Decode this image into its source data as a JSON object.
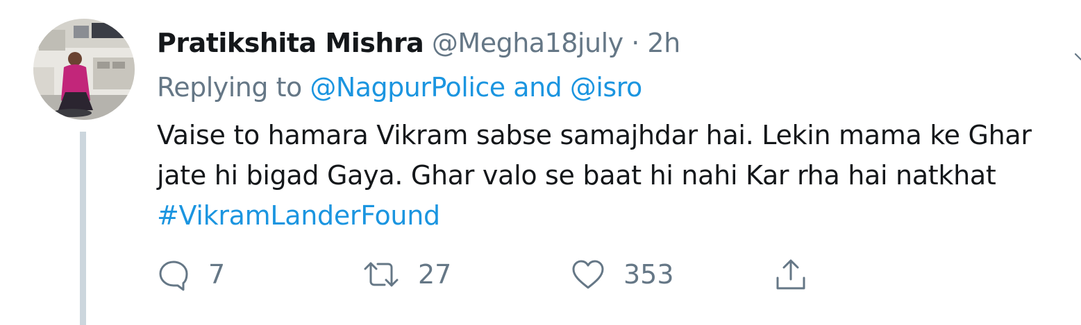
{
  "tweet": {
    "display_name": "Pratikshita Mishra",
    "handle": "@Megha18july",
    "separator": "·",
    "time": "2h",
    "reply": {
      "prefix": "Replying to",
      "mention_1": "@NagpurPolice",
      "conjunction": "and",
      "mention_2": "@isro"
    },
    "text_line_1": "Vaise to hamara Vikram sabse samajhdar hai. Lekin mama ke Ghar",
    "text_line_2": "jate hi bigad Gaya. Ghar valo se baat hi nahi Kar rha hai natkhat",
    "hashtag": "#VikramLanderFound",
    "actions": {
      "reply_count": "7",
      "retweet_count": "27",
      "like_count": "353"
    },
    "icons": {
      "reply": "speech-bubble-icon",
      "retweet": "retweet-arrows-icon",
      "like": "heart-icon",
      "share": "share-upload-icon",
      "menu": "chevron-down-icon"
    },
    "colors": {
      "text": "#14171a",
      "secondary": "#657786",
      "link": "#1b95e0",
      "thread_line": "#ccd6dd"
    }
  }
}
